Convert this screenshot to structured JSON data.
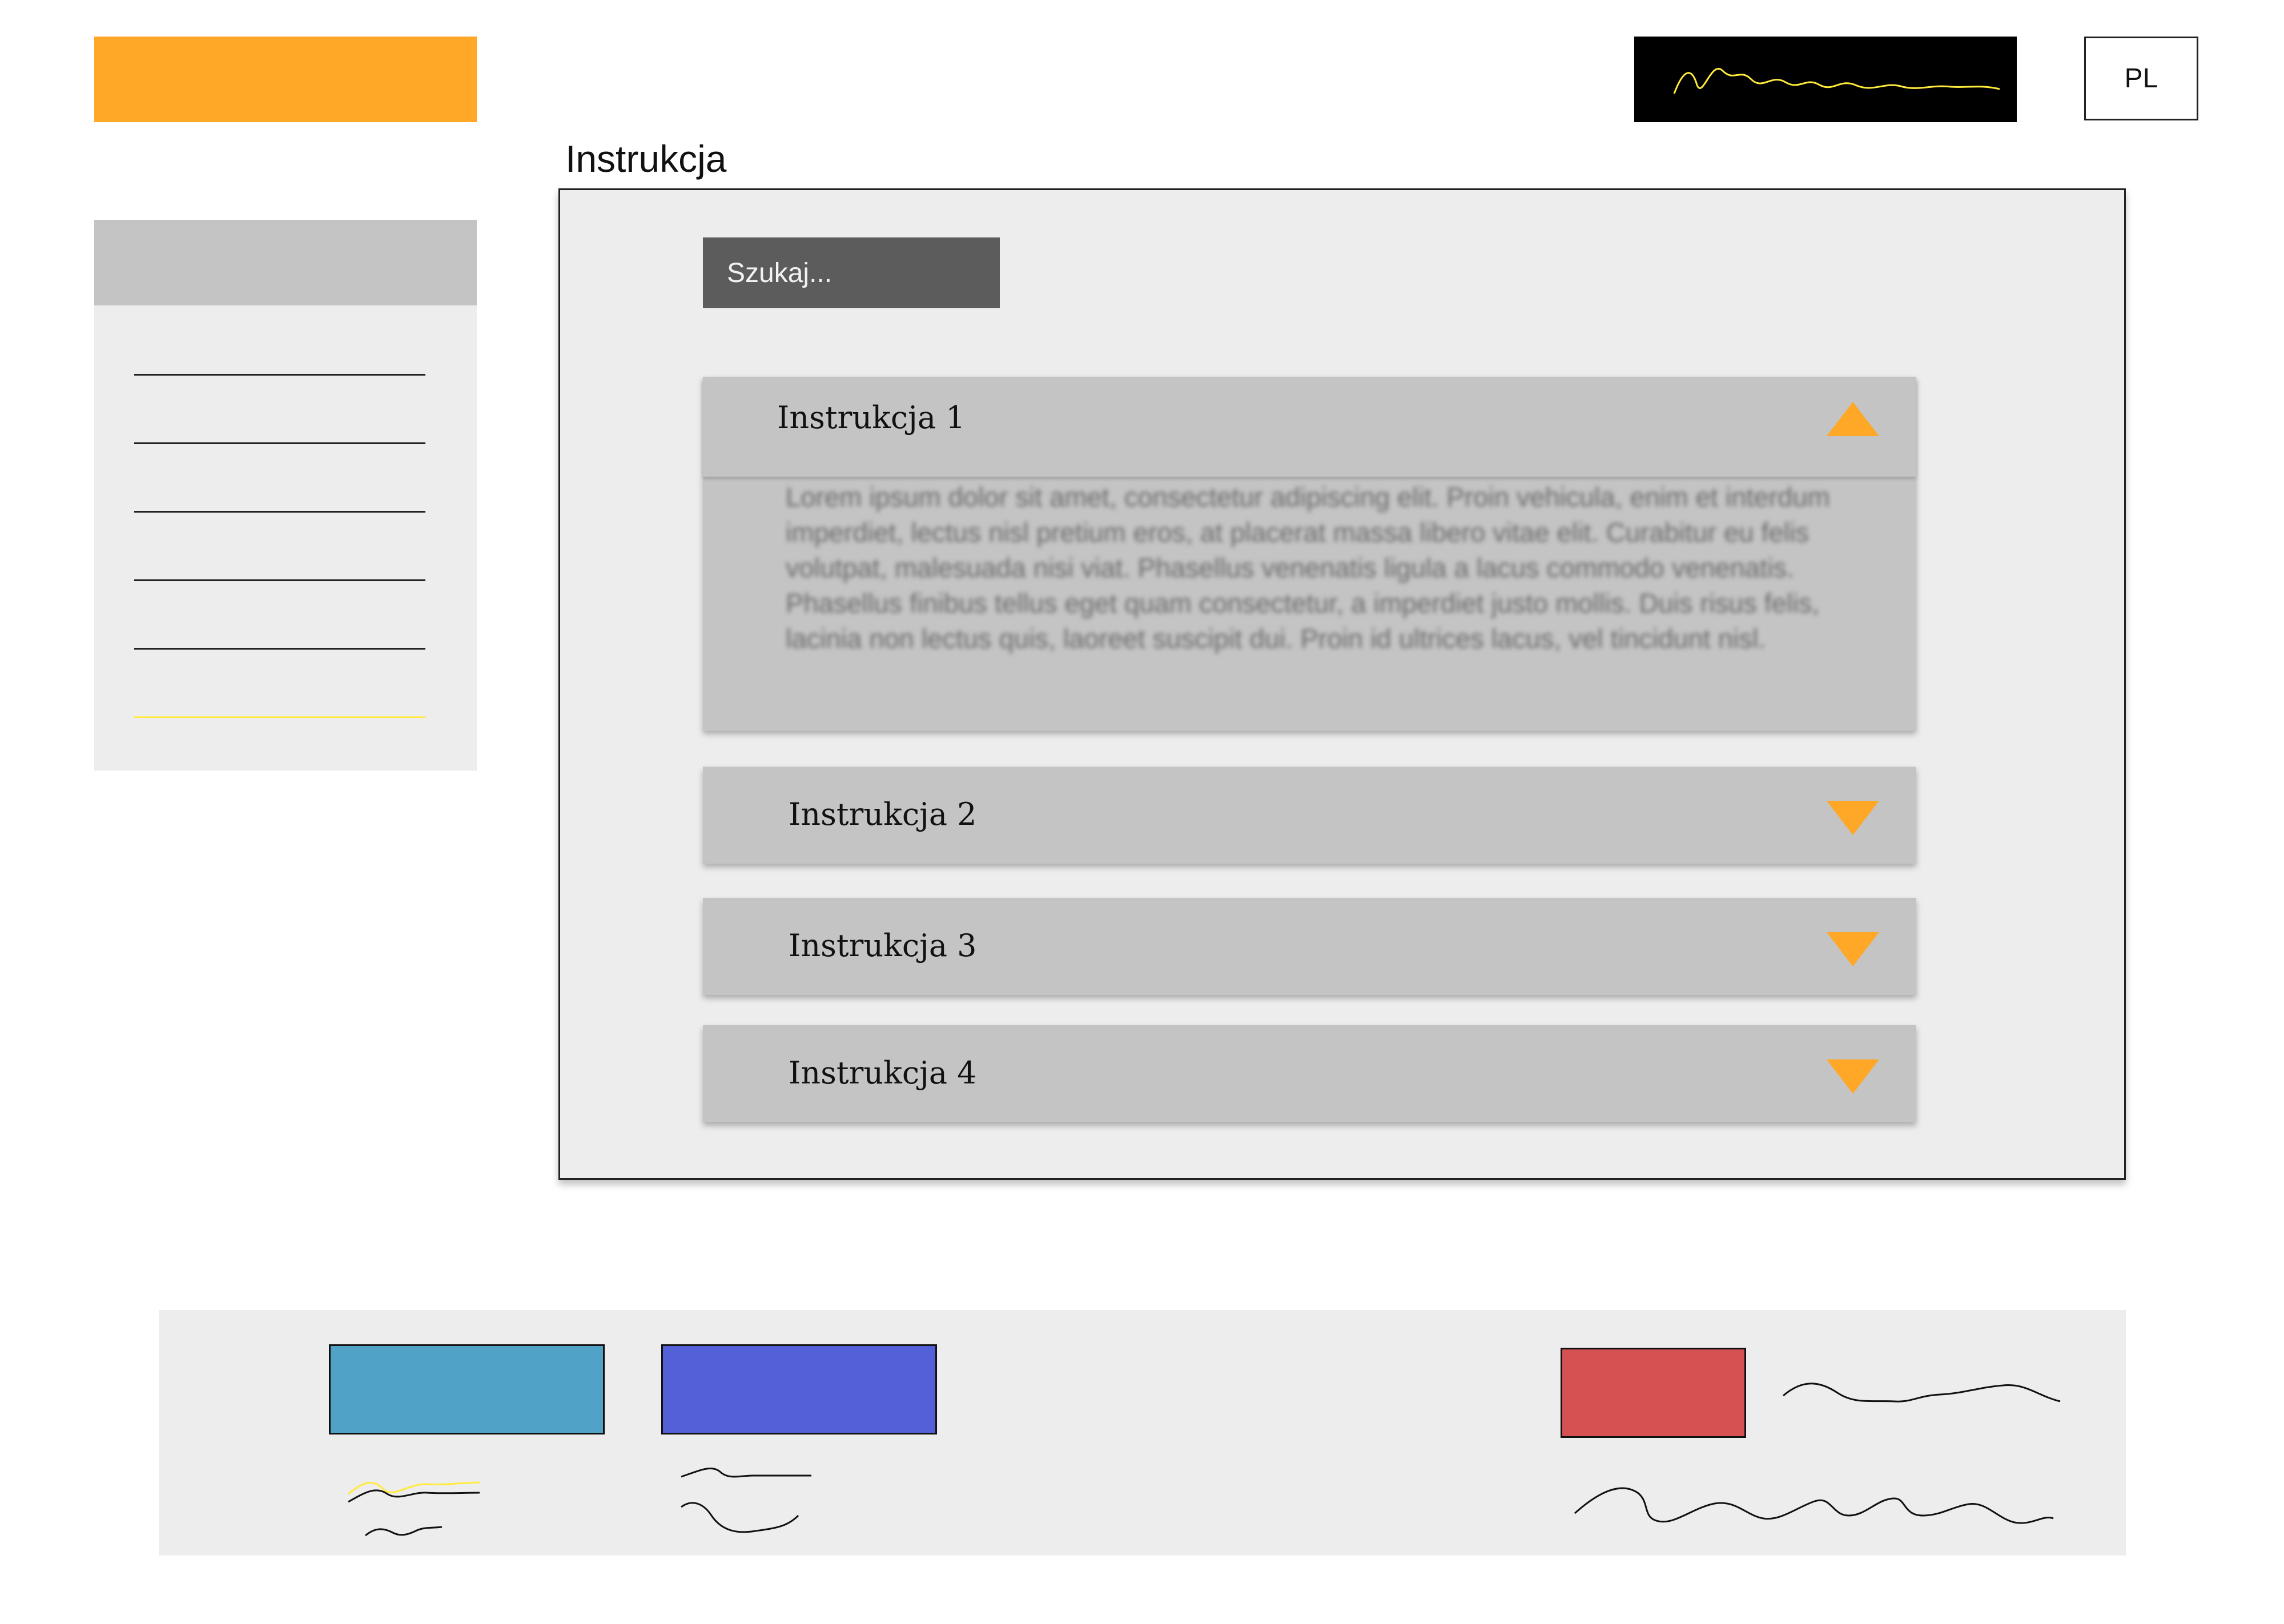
{
  "header": {
    "lang_label": "PL"
  },
  "page": {
    "title": "Instrukcja"
  },
  "search": {
    "placeholder": "Szukaj..."
  },
  "instructions": [
    {
      "title": "Instrukcja 1",
      "expanded": true,
      "body": "Lorem ipsum dolor sit amet, consectetur adipiscing elit. Proin vehicula, enim et interdum imperdiet, lectus nisl pretium eros, at placerat massa libero vitae elit. Curabitur eu felis volutpat, malesuada nisi viat. Phasellus venenatis ligula a lacus commodo venenatis. Phasellus finibus tellus eget quam consectetur, a imperdiet justo mollis. Duis risus felis, lacinia non lectus quis, laoreet suscipit dui. Proin id ultrices lacus, vel tincidunt nisl."
    },
    {
      "title": "Instrukcja 2",
      "expanded": false
    },
    {
      "title": "Instrukcja 3",
      "expanded": false
    },
    {
      "title": "Instrukcja 4",
      "expanded": false
    }
  ],
  "colors": {
    "accent": "#FFA726",
    "footer_teal": "#50A3C7",
    "footer_blue": "#5460D8",
    "footer_red": "#D65252",
    "highlight_yellow": "#FFEB3B"
  }
}
